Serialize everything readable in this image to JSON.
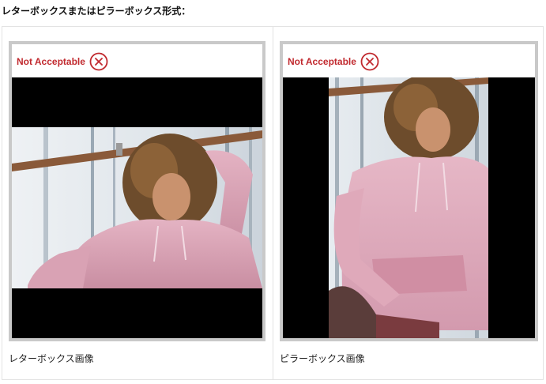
{
  "heading": "レターボックスまたはピラーボックス形式：",
  "examples": [
    {
      "status": "Not Acceptable",
      "status_icon": "x-circle-icon",
      "caption": "レターボックス画像",
      "format": "letterbox"
    },
    {
      "status": "Not Acceptable",
      "status_icon": "x-circle-icon",
      "caption": "ピラーボックス画像",
      "format": "pillarbox"
    }
  ],
  "colors": {
    "status_red": "#c12a2f",
    "frame_border": "#c9c9c9",
    "bar_black": "#000000",
    "hoodie_pink": "#d9a2b4"
  }
}
